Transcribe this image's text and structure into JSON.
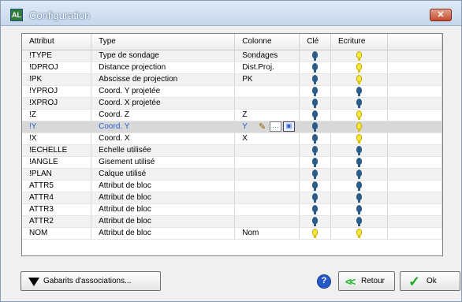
{
  "window": {
    "title": "Configuration",
    "close_label": "✕",
    "app_icon_label": "AL"
  },
  "table": {
    "columns": [
      "Attribut",
      "Type",
      "Colonne",
      "Clé",
      "Ecriture"
    ],
    "rows": [
      {
        "attribut": "!TYPE",
        "type": "Type de sondage",
        "colonne": "Sondages",
        "cle": "key",
        "ecriture": "bulb"
      },
      {
        "attribut": "!DPROJ",
        "type": "Distance projection",
        "colonne": "Dist.Proj.",
        "cle": "key",
        "ecriture": "bulb"
      },
      {
        "attribut": "!PK",
        "type": "Abscisse de projection",
        "colonne": "PK",
        "cle": "key",
        "ecriture": "bulb"
      },
      {
        "attribut": "!YPROJ",
        "type": "Coord. Y projetée",
        "colonne": "",
        "cle": "key",
        "ecriture": "key"
      },
      {
        "attribut": "!XPROJ",
        "type": "Coord. X projetée",
        "colonne": "",
        "cle": "key",
        "ecriture": "key"
      },
      {
        "attribut": "!Z",
        "type": "Coord. Z",
        "colonne": "Z",
        "cle": "key",
        "ecriture": "bulb"
      },
      {
        "attribut": "!Y",
        "type": "Coord. Y",
        "colonne": "Y",
        "cle": "key",
        "ecriture": "bulb",
        "selected": true
      },
      {
        "attribut": "!X",
        "type": "Coord. X",
        "colonne": "X",
        "cle": "key",
        "ecriture": "bulb"
      },
      {
        "attribut": "!ECHELLE",
        "type": "Echelle utilisée",
        "colonne": "",
        "cle": "key",
        "ecriture": "key"
      },
      {
        "attribut": "!ANGLE",
        "type": "Gisement utilisé",
        "colonne": "",
        "cle": "key",
        "ecriture": "key"
      },
      {
        "attribut": "!PLAN",
        "type": "Calque utilisé",
        "colonne": "",
        "cle": "key",
        "ecriture": "key"
      },
      {
        "attribut": "ATTR5",
        "type": "Attribut de bloc",
        "colonne": "",
        "cle": "key",
        "ecriture": "key"
      },
      {
        "attribut": "ATTR4",
        "type": "Attribut de bloc",
        "colonne": "",
        "cle": "key",
        "ecriture": "key"
      },
      {
        "attribut": "ATTR3",
        "type": "Attribut de bloc",
        "colonne": "",
        "cle": "key",
        "ecriture": "key"
      },
      {
        "attribut": "ATTR2",
        "type": "Attribut de bloc",
        "colonne": "",
        "cle": "key",
        "ecriture": "key"
      },
      {
        "attribut": "NOM",
        "type": "Attribut de bloc",
        "colonne": "Nom",
        "cle": "bulb",
        "ecriture": "bulb"
      }
    ]
  },
  "buttons": {
    "gabarits_label": "Gabarits d'associations...",
    "help_label": "?",
    "retour_label": "Retour",
    "retour_icon": "<<",
    "ok_label": "Ok",
    "ok_icon": "✓"
  },
  "colors": {
    "selected_text": "#2a5fcf",
    "key": "#2b5d88",
    "bulb": "#f5ea3b"
  }
}
